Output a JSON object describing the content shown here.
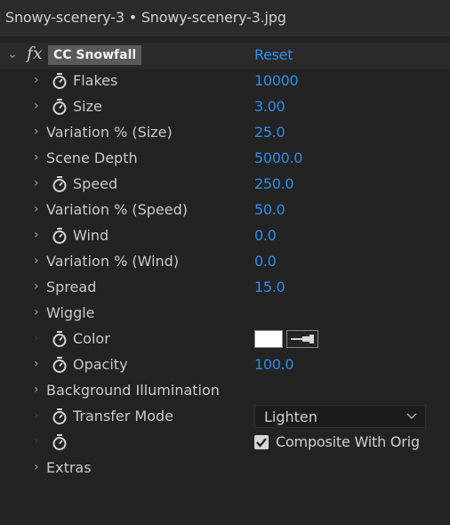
{
  "panel": {
    "title": "Snowy-scenery-3 • Snowy-scenery-3.jpg"
  },
  "effect": {
    "name": "CC Snowfall",
    "reset_label": "Reset"
  },
  "properties": [
    {
      "label": "Flakes",
      "value": "10000"
    },
    {
      "label": "Size",
      "value": "3.00"
    },
    {
      "label": "Variation % (Size)",
      "value": "25.0"
    },
    {
      "label": "Scene Depth",
      "value": "5000.0"
    },
    {
      "label": "Speed",
      "value": "250.0"
    },
    {
      "label": "Variation % (Speed)",
      "value": "50.0"
    },
    {
      "label": "Wind",
      "value": "0.0"
    },
    {
      "label": "Variation % (Wind)",
      "value": "0.0"
    },
    {
      "label": "Spread",
      "value": "15.0"
    },
    {
      "label": "Wiggle",
      "value": ""
    },
    {
      "label": "Color",
      "value": "",
      "color": "#ffffff"
    },
    {
      "label": "Opacity",
      "value": "100.0"
    },
    {
      "label": "Background Illumination",
      "value": ""
    },
    {
      "label": "Transfer Mode",
      "selected": "Lighten"
    },
    {
      "label": "",
      "checkbox_label": "Composite With Orig",
      "checked": true
    },
    {
      "label": "Extras",
      "value": ""
    }
  ],
  "colors": {
    "value_blue": "#2d8ceb",
    "background": "#232323"
  }
}
